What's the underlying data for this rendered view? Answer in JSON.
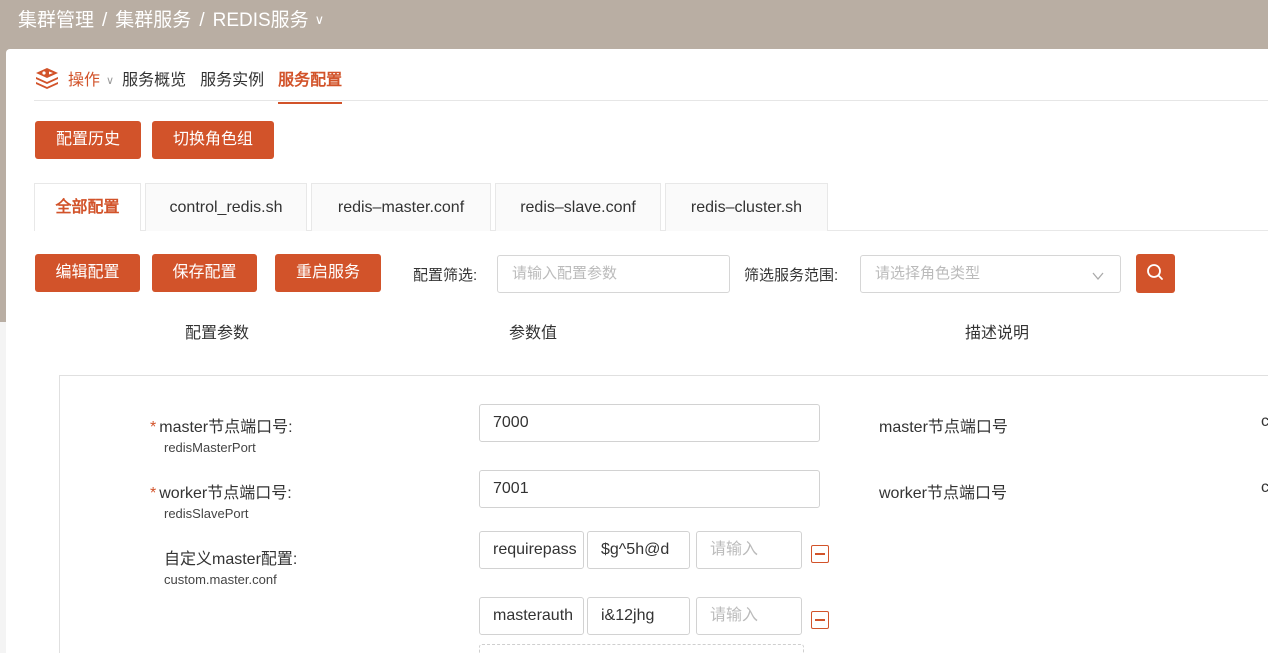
{
  "breadcrumb": {
    "part1": "集群管理",
    "sep1": "/",
    "part2": "集群服务",
    "sep2": "/",
    "part3": "REDIS服务",
    "chevron": "∨"
  },
  "nav": {
    "operate": "操作",
    "operate_chevron": "∨",
    "items": [
      "服务概览",
      "服务实例",
      "服务配置"
    ],
    "active_index": 2
  },
  "actions": {
    "history": "配置历史",
    "switch_group": "切换角色组"
  },
  "tabs": [
    "全部配置",
    "control_redis.sh",
    "redis–master.conf",
    "redis–slave.conf",
    "redis–cluster.sh"
  ],
  "toolbar": {
    "edit": "编辑配置",
    "save": "保存配置",
    "restart": "重启服务",
    "filter_label": "配置筛选:",
    "filter_placeholder": "请输入配置参数",
    "scope_label": "筛选服务范围:",
    "scope_placeholder": "请选择角色类型"
  },
  "columns": {
    "param": "配置参数",
    "value": "参数值",
    "desc": "描述说明"
  },
  "params": [
    {
      "required": "*",
      "label": "master节点端口号:",
      "key": "redisMasterPort",
      "value": "7000",
      "desc": "master节点端口号",
      "trail": "c"
    },
    {
      "required": "*",
      "label": "worker节点端口号:",
      "key": "redisSlavePort",
      "value": "7001",
      "desc": "worker节点端口号",
      "trail": "c"
    },
    {
      "label": "自定义master配置:",
      "key": "custom.master.conf",
      "rows": [
        {
          "k": "requirepass",
          "v": "$g^5h@d",
          "placeholder": "请输入"
        },
        {
          "k": "masterauth",
          "v": "i&12jhg",
          "placeholder": "请输入"
        }
      ]
    }
  ],
  "colors": {
    "accent": "#d2532a",
    "header_bg": "#b9aea3"
  },
  "icons": {
    "logo": "redis-logo-icon",
    "search": "search-icon",
    "remove": "minus-square-icon",
    "select": "chevron-down-icon"
  }
}
